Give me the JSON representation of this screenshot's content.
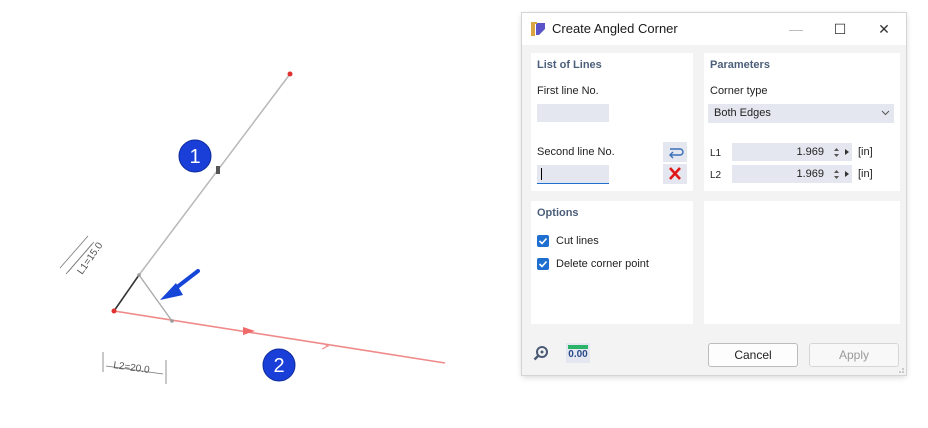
{
  "scene": {
    "marker1": "1",
    "marker2": "2",
    "dim1": "L1=15.0",
    "dim2": "L2=20.0"
  },
  "dialog": {
    "title": "Create Angled Corner",
    "window_buttons": {
      "minimize": "—",
      "maximize": "☐",
      "close": "✕"
    },
    "list_of_lines": {
      "title": "List of Lines",
      "first_line_label": "First line No.",
      "first_line_value": "",
      "second_line_label": "Second line No.",
      "second_line_value": ""
    },
    "parameters": {
      "title": "Parameters",
      "corner_type_label": "Corner type",
      "corner_type_value": "Both Edges",
      "l1_label": "L1",
      "l1_value": "1.969",
      "l1_unit": "[in]",
      "l2_label": "L2",
      "l2_value": "1.969",
      "l2_unit": "[in]"
    },
    "options": {
      "title": "Options",
      "cut_lines_label": "Cut lines",
      "cut_lines_checked": true,
      "delete_corner_label": "Delete corner point",
      "delete_corner_checked": true
    },
    "footer": {
      "units_icon_text": "0.00",
      "cancel_label": "Cancel",
      "apply_label": "Apply"
    }
  }
}
